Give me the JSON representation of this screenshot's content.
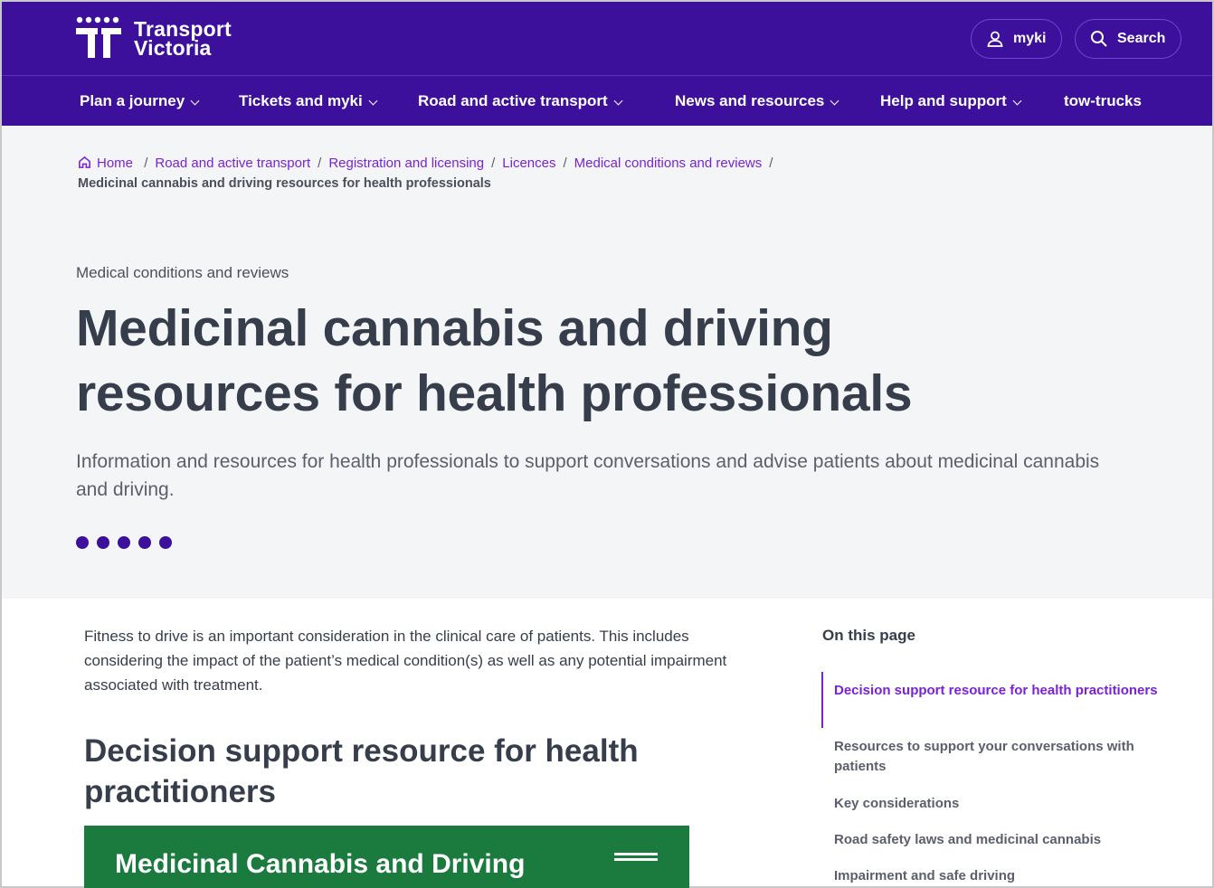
{
  "brand": {
    "line1": "Transport",
    "line2": "Victoria"
  },
  "header": {
    "myki_label": "myki",
    "search_label": "Search"
  },
  "nav": [
    {
      "label": "Plan a journey",
      "has_menu": true
    },
    {
      "label": "Tickets and myki",
      "has_menu": true
    },
    {
      "label": "Road and active transport",
      "has_menu": true
    },
    {
      "label": "News and resources",
      "has_menu": true
    },
    {
      "label": "Help and support",
      "has_menu": true
    },
    {
      "label": "tow-trucks",
      "has_menu": false
    }
  ],
  "breadcrumb": {
    "links": [
      "Home",
      "Road and active transport",
      "Registration and licensing",
      "Licences",
      "Medical conditions and reviews"
    ],
    "current": "Medicinal cannabis and driving resources for health professionals"
  },
  "hero": {
    "eyebrow": "Medical conditions and reviews",
    "title_line1": "Medicinal cannabis and driving",
    "title_line2": "resources for health professionals",
    "lede": "Information and resources for health professionals to support conversations and advise patients about medicinal cannabis and driving."
  },
  "content": {
    "intro": "Fitness to drive is an important consideration in the clinical care of patients. This includes considering the impact of the patient’s medical condition(s) as well as any potential impairment associated with treatment.",
    "section_heading": "Decision support resource for health practitioners",
    "banner_title": "Medicinal Cannabis and Driving"
  },
  "on_this_page": {
    "title": "On this page",
    "items": [
      "Decision support resource for health practitioners",
      "Resources to support your conversations with patients",
      "Key considerations",
      "Road safety laws and medicinal cannabis",
      "Impairment and safe driving"
    ],
    "active_index": 0
  },
  "colors": {
    "brand_purple": "#3c109b",
    "link_purple": "#7a22d6",
    "banner_green": "#1b7a3e",
    "hero_bg": "#f4f5f7"
  }
}
